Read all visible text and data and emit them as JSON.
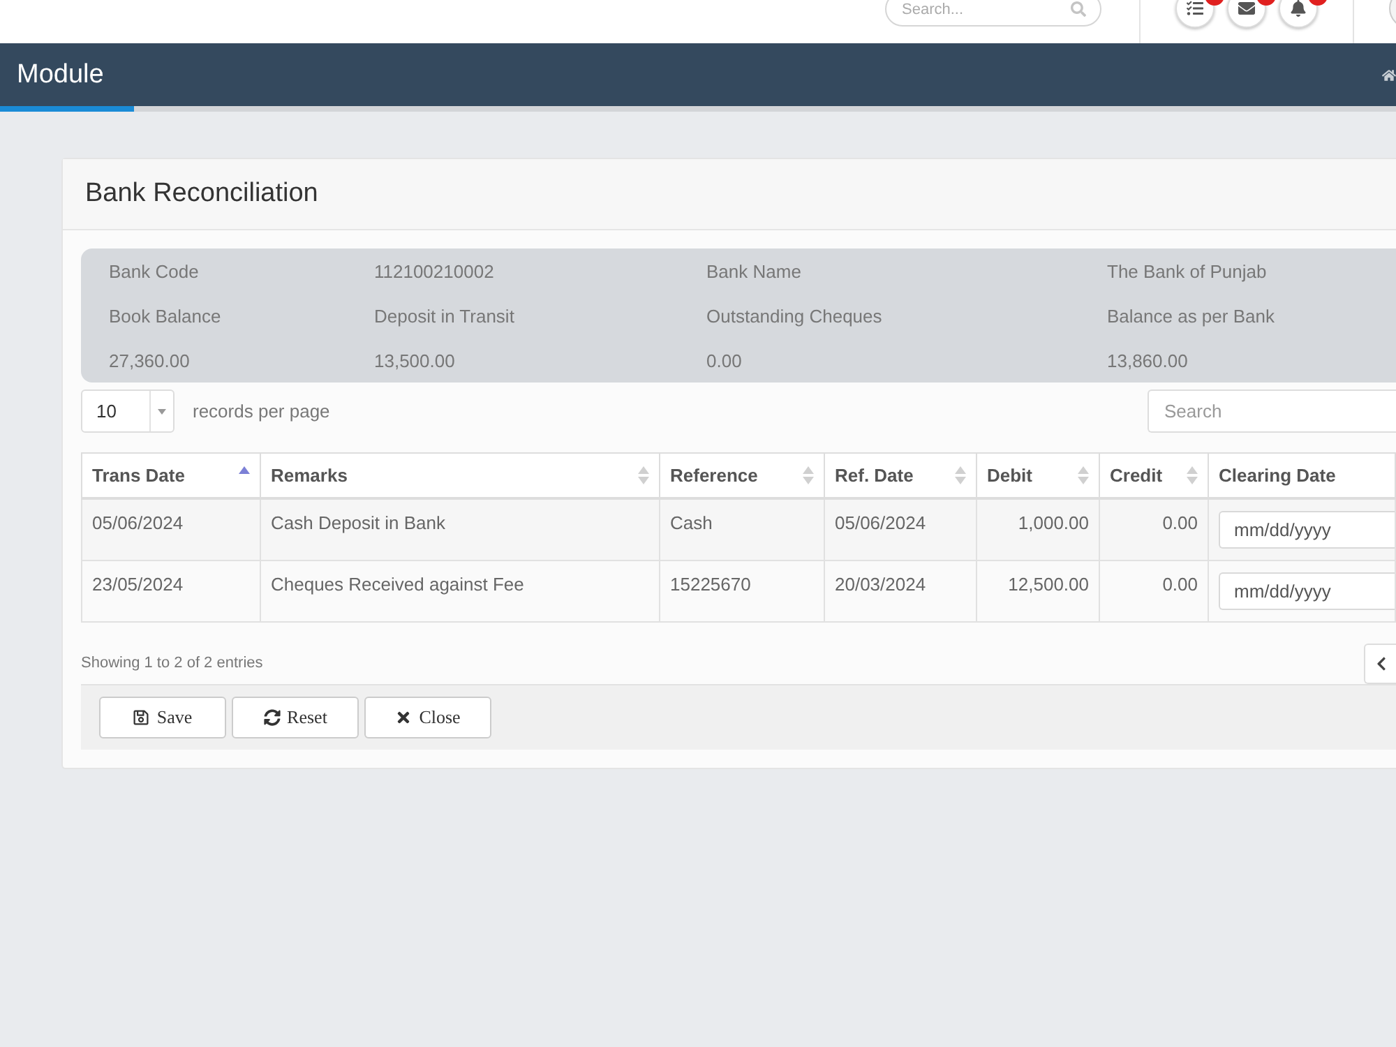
{
  "top_bar": {
    "search": {
      "placeholder": "Search..."
    },
    "icon_buttons": [
      {
        "kind": "tasks",
        "badge": true
      },
      {
        "kind": "mail",
        "badge": true
      },
      {
        "kind": "bell",
        "badge": true
      }
    ]
  },
  "module_bar": {
    "title": "Module"
  },
  "card": {
    "title": "Bank Reconciliation"
  },
  "bank_details": [
    {
      "label": "Bank Code",
      "value": "112100210002"
    },
    {
      "label": "Bank Name",
      "value": "The Bank of Punjab"
    }
  ],
  "balances": [
    {
      "label": "Book Balance",
      "value": "27,360.00"
    },
    {
      "label": "Deposit in Transit",
      "value": "13,500.00"
    },
    {
      "label": "Outstanding Cheques",
      "value": "0.00"
    },
    {
      "label": "Balance as per Bank",
      "value": "13,860.00"
    }
  ],
  "table_controls": {
    "page_size": "10",
    "page_size_label": "records per page",
    "search": {
      "placeholder": "Search"
    }
  },
  "table": {
    "columns": [
      {
        "label": "Trans Date",
        "kind": "text",
        "sortable": true,
        "sorted": true
      },
      {
        "label": "Remarks",
        "kind": "text",
        "sortable": true,
        "sorted": false
      },
      {
        "label": "Reference",
        "kind": "text",
        "sortable": true,
        "sorted": false
      },
      {
        "label": "Ref. Date",
        "kind": "text",
        "sortable": true,
        "sorted": false
      },
      {
        "label": "Debit",
        "kind": "amount",
        "sortable": true,
        "sorted": false
      },
      {
        "label": "Credit",
        "kind": "amount",
        "sortable": true,
        "sorted": false
      },
      {
        "label": "Clearing Date",
        "kind": "date_input",
        "sortable": false
      }
    ],
    "rows": [
      {
        "cells": [
          "05/06/2024",
          "Cash Deposit in Bank",
          "Cash",
          "05/06/2024",
          "1,000.00",
          "0.00"
        ],
        "clearing_date": {
          "placeholder": "mm/dd/yyyy"
        }
      },
      {
        "cells": [
          "23/05/2024",
          "Cheques Received against Fee",
          "15225670",
          "20/03/2024",
          "12,500.00",
          "0.00"
        ],
        "clearing_date": {
          "placeholder": "mm/dd/yyyy"
        }
      }
    ]
  },
  "table_info": "Showing 1 to 2 of 2 entries",
  "buttons": [
    {
      "kind": "save",
      "label": "Save"
    },
    {
      "kind": "reset",
      "label": "Reset"
    },
    {
      "kind": "close",
      "label": "Close"
    }
  ]
}
